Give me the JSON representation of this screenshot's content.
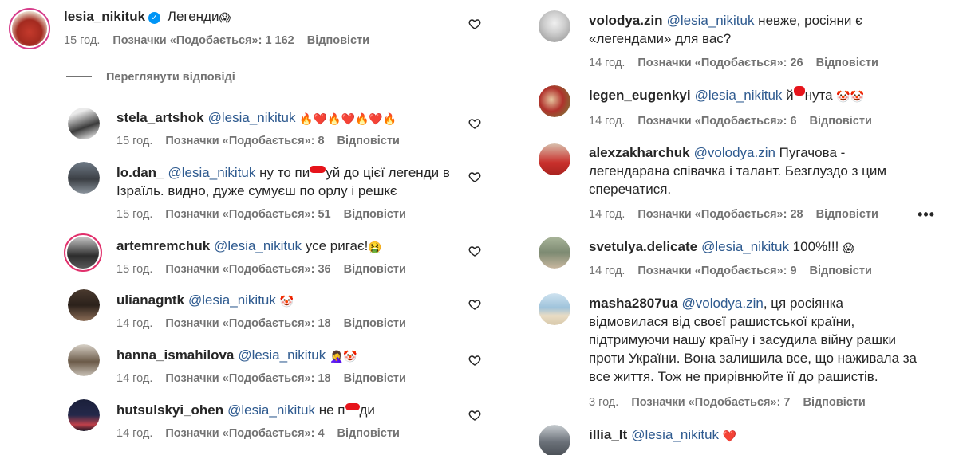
{
  "labels": {
    "likes_prefix": "Позначки «Подобається»: ",
    "reply": "Відповісти",
    "view_replies": "Переглянути відповіді"
  },
  "post": {
    "username": "lesia_nikituk",
    "text": " Легенди",
    "emoji": "😱",
    "time": "15 год.",
    "likes": "1 162"
  },
  "left_comments": [
    {
      "username": "stela_artshok",
      "mention": "@lesia_nikituk",
      "text": " ",
      "emoji": "🔥❤️🔥❤️🔥❤️🔥",
      "time": "15 год.",
      "likes": "8"
    },
    {
      "username": "lo.dan_",
      "mention": "@lesia_nikituk",
      "text_a": " ну то пи",
      "text_b": "уй до цієї легенди в",
      "line2": "Ізраїль. видно, дуже сумуєш по орлу і решкє",
      "time": "15 год.",
      "likes": "51"
    },
    {
      "username": "artemremchuk",
      "mention": "@lesia_nikituk",
      "text": " усе ригає!",
      "emoji": "🤮",
      "time": "15 год.",
      "likes": "36"
    },
    {
      "username": "ulianagntk",
      "mention": "@lesia_nikituk",
      "text": " ",
      "emoji": "🤡",
      "time": "14 год.",
      "likes": "18"
    },
    {
      "username": "hanna_ismahilova",
      "mention": "@lesia_nikituk",
      "text": " ",
      "emoji": "🤦‍♀️🤡",
      "time": "14 год.",
      "likes": "18"
    },
    {
      "username": "hutsulskyi_ohen",
      "mention": "@lesia_nikituk",
      "text_a": " не п",
      "text_b": "ди",
      "time": "14 год.",
      "likes": "4"
    }
  ],
  "right_comments": [
    {
      "username": "volodya.zin",
      "mention": "@lesia_nikituk",
      "text": " невже, росіяни є",
      "line2": "«легендами» для вас?",
      "time": "14 год.",
      "likes": "26"
    },
    {
      "username": "legen_eugenkyi",
      "mention": "@lesia_nikituk",
      "text_a": " й",
      "text_b": "нута ",
      "emoji": "🤡🤡",
      "time": "14 год.",
      "likes": "6"
    },
    {
      "username": "alexzakharchuk",
      "mention": "@volodya.zin",
      "text": " Пугачова -",
      "line2": "легендарана співачка і талант. Безглуздо з цим",
      "line3": "сперечатися.",
      "time": "14 год.",
      "likes": "28",
      "more": "•••"
    },
    {
      "username": "svetulya.delicate",
      "mention": "@lesia_nikituk",
      "text": " 100%!!! ",
      "emoji": "😱",
      "time": "14 год.",
      "likes": "9"
    },
    {
      "username": "masha2807ua",
      "mention": "@volodya.zin",
      "text": ", ця росіянка",
      "line2": "відмовилася від своєї рашистської країни,",
      "line3": "підтримуючи нашу країну і засудила війну рашки",
      "line4": "проти України. Вона залишила все, що наживала за",
      "line5": "все життя. Тож не прирівнюйте її до рашистів.",
      "time": "3 год.",
      "likes": "7"
    },
    {
      "username": "illia_lt",
      "mention": "@lesia_nikituk",
      "text": " ",
      "emoji": "❤️"
    }
  ],
  "colors": {
    "mention": "#2e5a8f",
    "meta": "#737373",
    "verified": "#0095f6",
    "redaction": "#e6141b"
  },
  "icons": [
    "heart-outline-icon",
    "verified-badge-icon",
    "more-options-icon"
  ]
}
